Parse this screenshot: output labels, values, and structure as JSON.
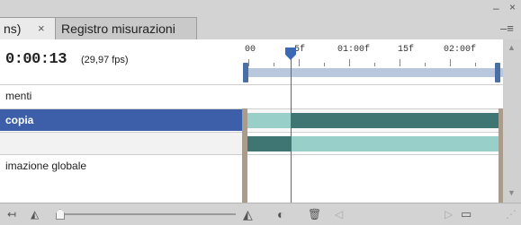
{
  "tabs": [
    {
      "label": "ns)",
      "close": "×"
    },
    {
      "label": "Registro misurazioni"
    }
  ],
  "window_buttons": {
    "minimize": "–",
    "close": "×",
    "menu": "–≡"
  },
  "header": {
    "timecode": "0:00:13",
    "fps": "(29,97 fps)"
  },
  "ruler": {
    "labels": [
      "00",
      "5f",
      "01:00f",
      "15f",
      "02:00f"
    ]
  },
  "layers": [
    {
      "name": "menti"
    },
    {
      "name": "copia",
      "selected": true
    },
    {
      "name": ""
    },
    {
      "name": "imazione globale"
    }
  ],
  "footer": {
    "icons": [
      "nav-icon",
      "mountain-small-icon",
      "mountain-large-icon",
      "onion-skin-icon",
      "trash-icon",
      "frames-icon"
    ]
  },
  "colors": {
    "selected_row": "#3d5ea8",
    "bar_light": "#98cfc9",
    "bar_dark": "#3f7573",
    "playhead": "#d23a3a"
  }
}
